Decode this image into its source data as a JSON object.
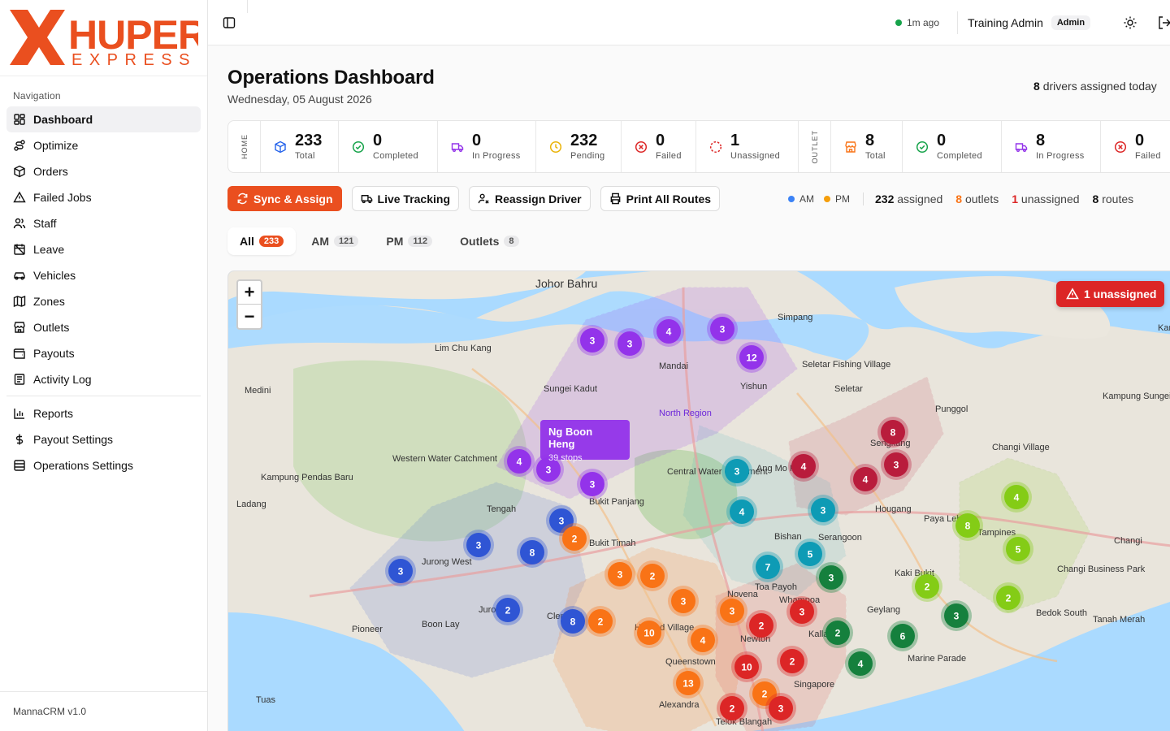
{
  "brand": {
    "top": "HUPER",
    "bottom": "EXPRESS",
    "color": "#ea4f1f"
  },
  "sidebar": {
    "section_label": "Navigation",
    "items": [
      {
        "label": "Dashboard",
        "icon": "dashboard-icon",
        "active": true
      },
      {
        "label": "Optimize",
        "icon": "route-icon"
      },
      {
        "label": "Orders",
        "icon": "package-icon"
      },
      {
        "label": "Failed Jobs",
        "icon": "warning-icon"
      },
      {
        "label": "Staff",
        "icon": "users-icon"
      },
      {
        "label": "Leave",
        "icon": "calendar-off-icon"
      },
      {
        "label": "Vehicles",
        "icon": "car-icon"
      },
      {
        "label": "Zones",
        "icon": "map-icon"
      },
      {
        "label": "Outlets",
        "icon": "store-icon"
      },
      {
        "label": "Payouts",
        "icon": "wallet-icon"
      },
      {
        "label": "Activity Log",
        "icon": "log-icon"
      }
    ],
    "items2": [
      {
        "label": "Reports",
        "icon": "chart-icon"
      },
      {
        "label": "Payout Settings",
        "icon": "dollar-icon"
      },
      {
        "label": "Operations Settings",
        "icon": "settings-icon"
      }
    ],
    "footer": "MannaCRM v1.0"
  },
  "topbar": {
    "sync_status": "1m ago",
    "user_name": "Training Admin",
    "user_role": "Admin"
  },
  "page": {
    "title": "Operations Dashboard",
    "date": "Wednesday, 05 August 2026",
    "drivers_count": "8",
    "drivers_text": "drivers assigned today"
  },
  "stats": {
    "home_label": "HOME",
    "outlet_label": "OUTLET",
    "home": [
      {
        "value": "233",
        "label": "Total",
        "color": "#2563eb"
      },
      {
        "value": "0",
        "label": "Completed",
        "color": "#16a34a"
      },
      {
        "value": "0",
        "label": "In Progress",
        "color": "#9333ea"
      },
      {
        "value": "232",
        "label": "Pending",
        "color": "#eab308"
      },
      {
        "value": "0",
        "label": "Failed",
        "color": "#dc2626"
      },
      {
        "value": "1",
        "label": "Unassigned",
        "color": "#dc2626"
      }
    ],
    "outlet": [
      {
        "value": "8",
        "label": "Total",
        "color": "#f97316"
      },
      {
        "value": "0",
        "label": "Completed",
        "color": "#16a34a"
      },
      {
        "value": "8",
        "label": "In Progress",
        "color": "#9333ea"
      },
      {
        "value": "0",
        "label": "Failed",
        "color": "#dc2626"
      }
    ]
  },
  "actions": {
    "sync": "Sync & Assign",
    "live": "Live Tracking",
    "reassign": "Reassign Driver",
    "print": "Print All Routes"
  },
  "legend": {
    "am": "AM",
    "pm": "PM",
    "am_color": "#3b82f6",
    "pm_color": "#f59e0b",
    "assigned_n": "232",
    "assigned": "assigned",
    "outlets_n": "8",
    "outlets": "outlets",
    "unassigned_n": "1",
    "unassigned": "unassigned",
    "routes_n": "8",
    "routes": "routes"
  },
  "tabs": [
    {
      "label": "All",
      "count": "233",
      "active": true
    },
    {
      "label": "AM",
      "count": "121"
    },
    {
      "label": "PM",
      "count": "112"
    },
    {
      "label": "Outlets",
      "count": "8"
    }
  ],
  "map": {
    "unassigned_alert": "1 unassigned",
    "tooltip_name": "Ng Boon Heng",
    "tooltip_stops": "39 stops",
    "place_labels": [
      "Johor Bahru",
      "Lim Chu Kang",
      "Mandai",
      "Yishun",
      "Seletar",
      "Simpang",
      "Sungei Kadut",
      "North Region",
      "Punggol",
      "Sengkang",
      "Changi Village",
      "Western Water Catchment",
      "Central Water Catchment",
      "Ang Mo Kio",
      "Hougang",
      "Paya Lebar",
      "Tengah",
      "Bukit Panjang",
      "Bukit Timah",
      "Bishan",
      "Serangoon",
      "Kaki Bukit",
      "Tampines",
      "Changi",
      "Jurong West",
      "Jurong",
      "Clementi",
      "Toa Payoh",
      "Whampoa",
      "Geylang",
      "Changi Business Park",
      "Pioneer",
      "Boon Lay",
      "Holland Village",
      "Novena",
      "Kallang",
      "Bedok South",
      "Tanah Merah",
      "Queenstown",
      "Newton",
      "Marine Parade",
      "Singapore",
      "Alexandra",
      "Tuas",
      "Telok Blangah",
      "Medini",
      "Kampung Pendas Baru",
      "Kampung Pasir Putih",
      "Kampung Sungei Durian",
      "Seletar Fishing Village",
      "Ladang"
    ],
    "clusters": [
      {
        "route": "purple",
        "value": 3
      },
      {
        "route": "purple",
        "value": 3
      },
      {
        "route": "purple",
        "value": 4
      },
      {
        "route": "purple",
        "value": 3
      },
      {
        "route": "purple",
        "value": 12
      },
      {
        "route": "purple",
        "value": 4
      },
      {
        "route": "purple",
        "value": 3
      },
      {
        "route": "purple",
        "value": 3
      },
      {
        "route": "crimson",
        "value": 8
      },
      {
        "route": "crimson",
        "value": 4
      },
      {
        "route": "crimson",
        "value": 4
      },
      {
        "route": "crimson",
        "value": 3
      },
      {
        "route": "teal",
        "value": 3
      },
      {
        "route": "teal",
        "value": 4
      },
      {
        "route": "teal",
        "value": 3
      },
      {
        "route": "teal",
        "value": 5
      },
      {
        "route": "teal",
        "value": 7
      },
      {
        "route": "lime",
        "value": 4
      },
      {
        "route": "lime",
        "value": 8
      },
      {
        "route": "lime",
        "value": 5
      },
      {
        "route": "lime",
        "value": 2
      },
      {
        "route": "lime",
        "value": 2
      },
      {
        "route": "blue",
        "value": 3
      },
      {
        "route": "blue",
        "value": 3
      },
      {
        "route": "blue",
        "value": 8
      },
      {
        "route": "blue",
        "value": 3
      },
      {
        "route": "blue",
        "value": 2
      },
      {
        "route": "blue",
        "value": 8
      },
      {
        "route": "orange",
        "value": 2
      },
      {
        "route": "orange",
        "value": 3
      },
      {
        "route": "orange",
        "value": 2
      },
      {
        "route": "orange",
        "value": 3
      },
      {
        "route": "orange",
        "value": 2
      },
      {
        "route": "orange",
        "value": 10
      },
      {
        "route": "orange",
        "value": 4
      },
      {
        "route": "orange",
        "value": 3
      },
      {
        "route": "orange",
        "value": 13
      },
      {
        "route": "orange",
        "value": 2
      },
      {
        "route": "red",
        "value": 3
      },
      {
        "route": "red",
        "value": 2
      },
      {
        "route": "red",
        "value": 10
      },
      {
        "route": "red",
        "value": 2
      },
      {
        "route": "red",
        "value": 2
      },
      {
        "route": "red",
        "value": 3
      },
      {
        "route": "green",
        "value": 3
      },
      {
        "route": "green",
        "value": 2
      },
      {
        "route": "green",
        "value": 6
      },
      {
        "route": "green",
        "value": 4
      },
      {
        "route": "green",
        "value": 3
      }
    ],
    "route_colors": {
      "purple": "#9333ea",
      "crimson": "#b91c3c",
      "teal": "#0e9bb5",
      "lime": "#84cc16",
      "blue": "#2f55d4",
      "orange": "#f97316",
      "red": "#dc2626",
      "green": "#15803d"
    }
  }
}
